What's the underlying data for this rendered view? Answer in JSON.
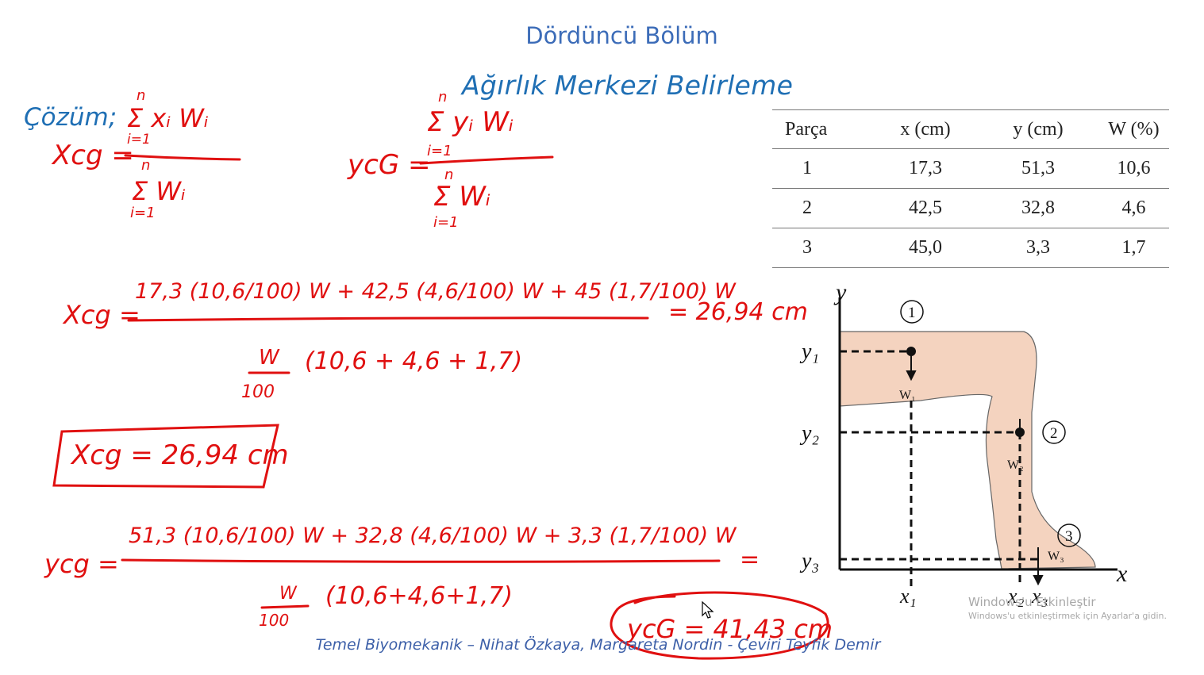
{
  "header": {
    "chapter": "Dördüncü Bölüm",
    "title": "Ağırlık Merkezi Belirleme"
  },
  "solution_label": "Çözüm;",
  "table": {
    "headers": [
      "Parça",
      "x (cm)",
      "y (cm)",
      "W (%)"
    ],
    "rows": [
      [
        "1",
        "17,3",
        "51,3",
        "10,6"
      ],
      [
        "2",
        "42,5",
        "32,8",
        "4,6"
      ],
      [
        "3",
        "45,0",
        "3,3",
        "1,7"
      ]
    ]
  },
  "handwriting": {
    "xcg_label": "Xcg =",
    "xcg_sum_num": "Σ xᵢ Wᵢ",
    "xcg_sum_den": "Σ Wᵢ",
    "ycg_label": "ycG =",
    "ycg_sum_num": "Σ yᵢ Wᵢ",
    "ycg_sum_den": "Σ Wᵢ",
    "sum_top": "n",
    "sum_bottom": "i=1",
    "xcg_calc_label": "Xcg =",
    "xcg_calc_num": "17,3 (10,6/100) W + 42,5 (4,6/100) W + 45 (1,7/100) W",
    "xcg_calc_result": "= 26,94 cm",
    "xcg_calc_den_frac_top": "W",
    "xcg_calc_den_frac_bot": "100",
    "xcg_calc_den": "(10,6 + 4,6 + 1,7)",
    "xcg_boxed": "Xcg = 26,94 cm",
    "ycg_calc_label": "ycg =",
    "ycg_calc_num": "51,3 (10,6/100) W + 32,8 (4,6/100) W + 3,3 (1,7/100) W",
    "ycg_calc_eq": "=",
    "ycg_calc_den_frac_top": "W",
    "ycg_calc_den_frac_bot": "100",
    "ycg_calc_den": "(10,6+4,6+1,7)",
    "ycg_circled": "ycG = 41,43 cm"
  },
  "diagram": {
    "axis_y": "y",
    "axis_x": "x",
    "y_labels": [
      "y₁",
      "y₂",
      "y₃"
    ],
    "x_labels": [
      "x₁",
      "x₂",
      "x₃"
    ],
    "weights": [
      "W₁",
      "W₂",
      "W₃"
    ],
    "markers": [
      "1",
      "2",
      "3"
    ],
    "fill_color": "#f4d3bf"
  },
  "footer": "Temel Biyomekanik – Nihat Özkaya, Margareta Nordin - Çeviri Teyfik Demir",
  "watermark": {
    "line1": "Windows'u Etkinleştir",
    "line2": "Windows'u etkinleştirmek için Ayarlar'a gidin."
  },
  "colors": {
    "handwriting": "#e01010",
    "title": "#1f6fb4",
    "chapter": "#3c6cb8"
  }
}
